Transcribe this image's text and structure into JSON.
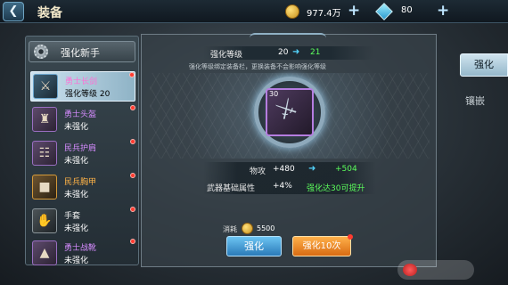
{
  "header": {
    "back_icon": "back-arrow-icon",
    "title": "装备",
    "gold": "977.4万",
    "diamonds": "80",
    "plus": "+"
  },
  "left_panel": {
    "title": "强化新手",
    "items": [
      {
        "name": "勇士长剑",
        "status": "强化等级 20",
        "selected": true,
        "color": "#d68cff"
      },
      {
        "name": "勇士头盔",
        "status": "未强化",
        "selected": false,
        "color": "#d68cff"
      },
      {
        "name": "民兵护肩",
        "status": "未强化",
        "selected": false,
        "color": "#d68cff"
      },
      {
        "name": "民兵胸甲",
        "status": "未强化",
        "selected": false,
        "color": "#ffb347"
      },
      {
        "name": "手套",
        "status": "未强化",
        "selected": false,
        "color": "#f2f2f2"
      },
      {
        "name": "勇士战靴",
        "status": "未强化",
        "selected": false,
        "color": "#d68cff"
      }
    ]
  },
  "main": {
    "level_label": "强化等级",
    "level_from": "20",
    "level_to": "21",
    "hint": "强化等级绑定装备栏，更换装备不会影响强化等级",
    "weapon_level": "30",
    "stats": [
      {
        "label": "物攻",
        "value": "+480",
        "new_value": "+504"
      },
      {
        "label": "武器基础属性",
        "value": "+4%",
        "new_value": "强化达30可提升"
      }
    ],
    "cost_label": "消耗",
    "cost_value": "5500",
    "enhance_btn": "强化",
    "enhance10_btn": "强化10次"
  },
  "tabs": {
    "enhance": "强化",
    "inlay": "镶嵌"
  }
}
